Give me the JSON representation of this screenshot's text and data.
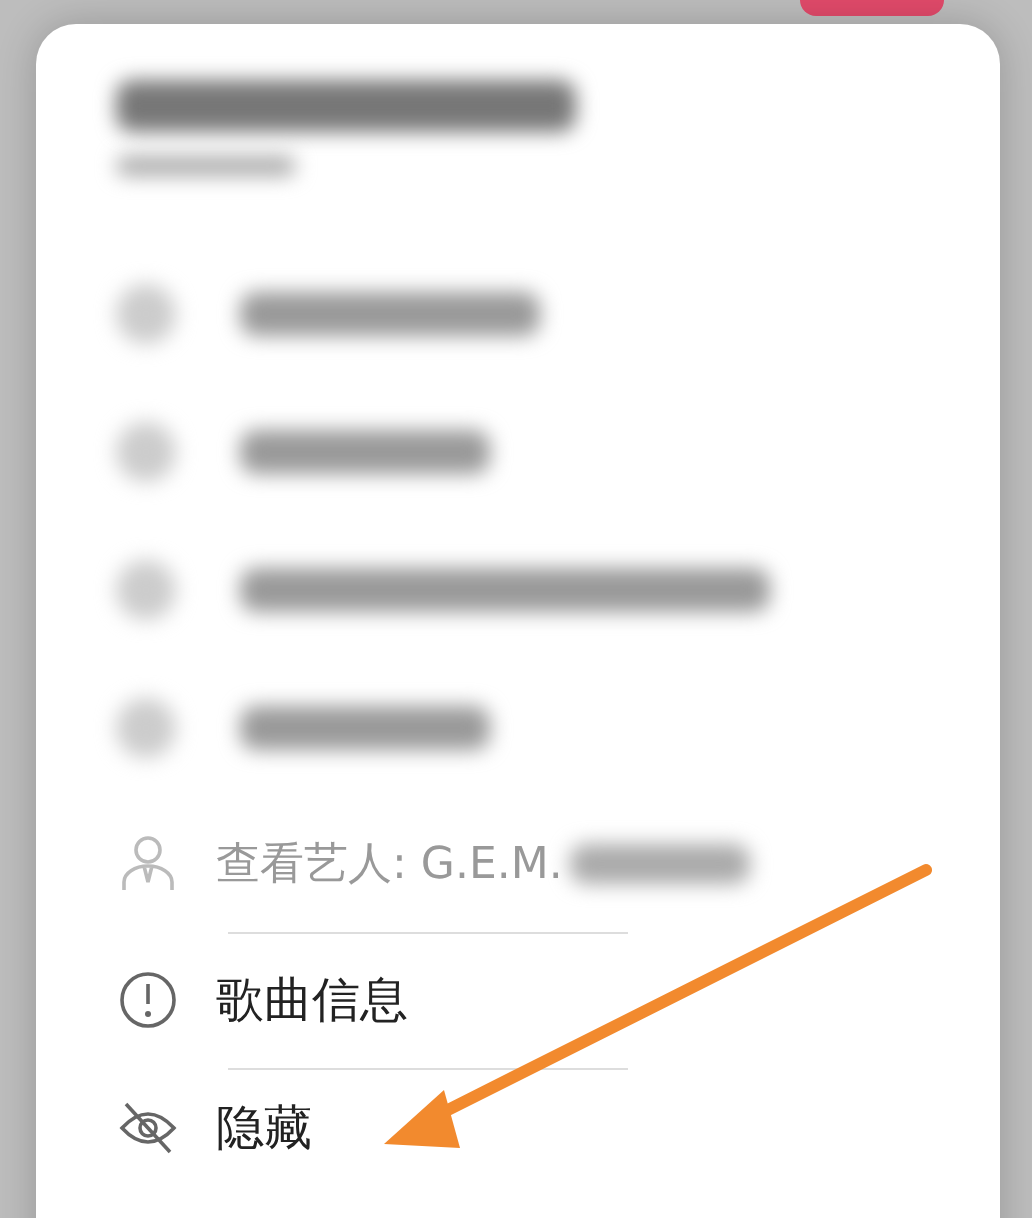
{
  "menu": [
    {
      "kind": "blurred"
    },
    {
      "kind": "blurred"
    },
    {
      "kind": "blurred"
    },
    {
      "kind": "blurred"
    },
    {
      "kind": "artist",
      "label": "查看艺人: G.E.M."
    },
    {
      "kind": "info",
      "label": "歌曲信息"
    },
    {
      "kind": "hide",
      "label": "隐藏"
    }
  ]
}
